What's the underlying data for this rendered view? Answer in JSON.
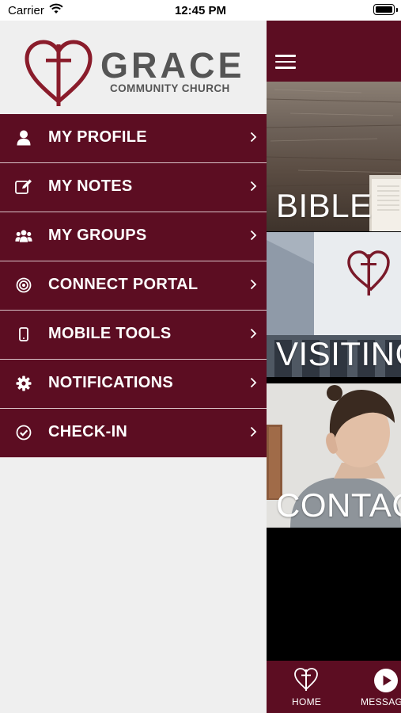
{
  "status_bar": {
    "carrier": "Carrier",
    "time": "12:45 PM"
  },
  "logo": {
    "word": "GRACE",
    "subtitle": "COMMUNITY CHURCH"
  },
  "menu": {
    "items": [
      {
        "label": "MY PROFILE",
        "icon": "user-icon"
      },
      {
        "label": "MY NOTES",
        "icon": "edit-note-icon"
      },
      {
        "label": "MY GROUPS",
        "icon": "group-icon"
      },
      {
        "label": "CONNECT PORTAL",
        "icon": "target-icon"
      },
      {
        "label": "MOBILE TOOLS",
        "icon": "mobile-phone-icon"
      },
      {
        "label": "NOTIFICATIONS",
        "icon": "gear-icon"
      },
      {
        "label": "CHECK-IN",
        "icon": "check-circle-icon"
      }
    ]
  },
  "tiles": [
    {
      "label": "BIBLE"
    },
    {
      "label": "VISITING"
    },
    {
      "label": "CONTACT"
    }
  ],
  "tabbar": {
    "home_label": "HOME",
    "messages_label": "MESSAGES"
  },
  "colors": {
    "brand": "#5c0d22",
    "drawer_bg": "#efefef",
    "logo_red": "#8a1c2b",
    "logo_grey": "#555555"
  }
}
